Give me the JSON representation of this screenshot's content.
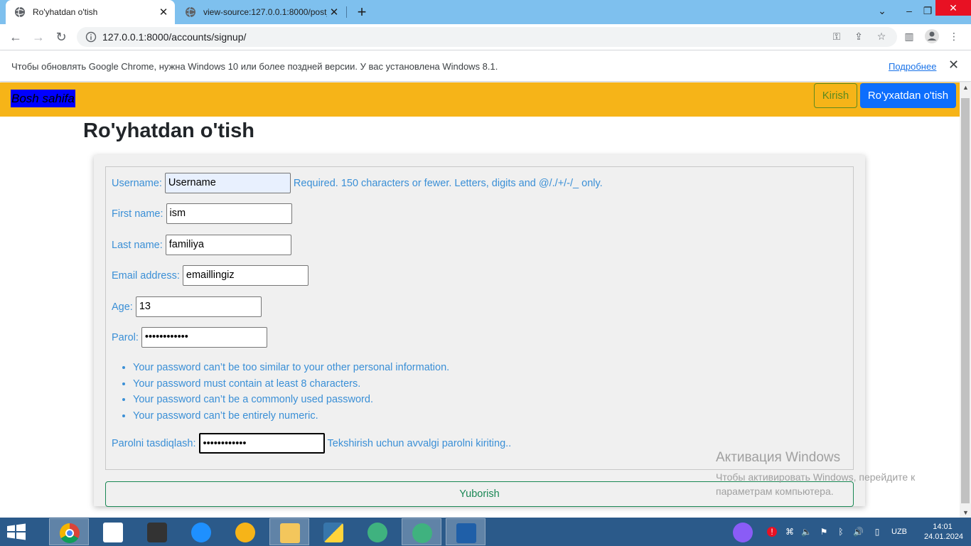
{
  "browser": {
    "tabs": [
      {
        "title": "Ro'yhatdan o'tish",
        "active": true
      },
      {
        "title": "view-source:127.0.0.1:8000/post_",
        "active": false
      }
    ],
    "url": "127.0.0.1:8000/accounts/signup/",
    "infobar": {
      "message": "Чтобы обновлять Google Chrome, нужна Windows 10 или более поздней версии. У вас установлена Windows 8.1.",
      "link": "Подробнее"
    }
  },
  "navbar": {
    "home": "Bosh sahifa",
    "login": "Kirish",
    "signup": "Ro'yxatdan o'tish",
    "color": "#f6b418"
  },
  "page": {
    "title": "Ro'yhatdan o'tish"
  },
  "form": {
    "username": {
      "label": "Username:",
      "value": "Username",
      "help": "Required. 150 characters or fewer. Letters, digits and @/./+/-/_ only."
    },
    "first_name": {
      "label": "First name:",
      "value": "ism"
    },
    "last_name": {
      "label": "Last name:",
      "value": "familiya"
    },
    "email": {
      "label": "Email address:",
      "value": "emaillingiz"
    },
    "age": {
      "label": "Age:",
      "value": "13"
    },
    "password": {
      "label": "Parol:",
      "value": "••••••••••••"
    },
    "password_hints": [
      "Your password can’t be too similar to your other personal information.",
      "Your password must contain at least 8 characters.",
      "Your password can’t be a commonly used password.",
      "Your password can’t be entirely numeric."
    ],
    "password_confirm": {
      "label": "Parolni tasdiqlash:",
      "value": "••••••••••••",
      "help": "Tekshirish uchun avvalgi parolni kiriting.."
    },
    "submit": "Yuborish"
  },
  "watermark": {
    "title": "Активация Windows",
    "line1": "Чтобы активировать Windows, перейдите к",
    "line2": "параметрам компьютера."
  },
  "taskbar": {
    "lang": "UZB",
    "time": "14:01",
    "date": "24.01.2024"
  }
}
